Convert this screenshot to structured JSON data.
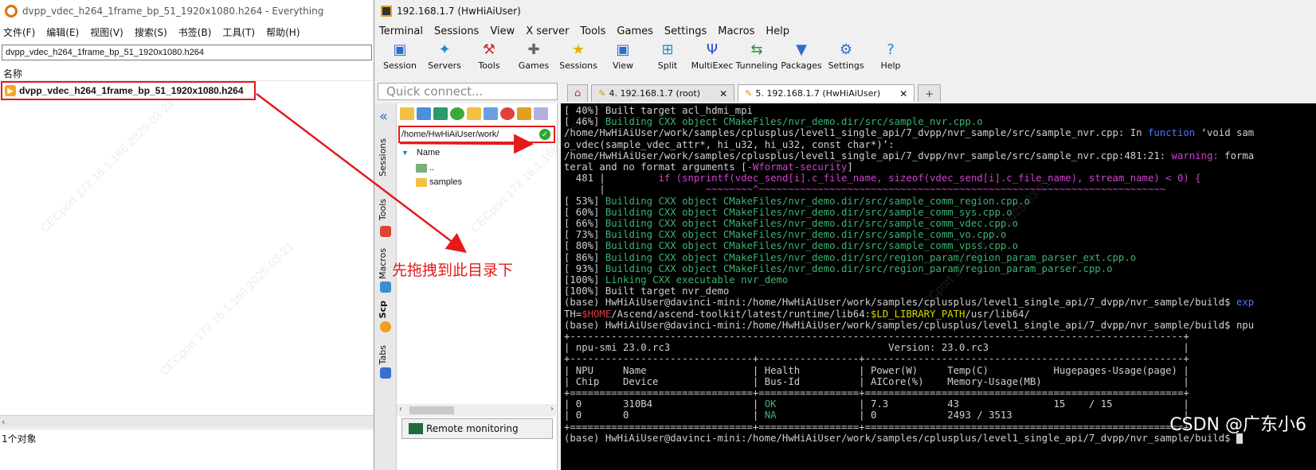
{
  "everything": {
    "title": "dvpp_vdec_h264_1frame_bp_51_1920x1080.h264 - Everything",
    "menu": [
      "文件(F)",
      "编辑(E)",
      "视图(V)",
      "搜索(S)",
      "书签(B)",
      "工具(T)",
      "帮助(H)"
    ],
    "search_value": "dvpp_vdec_h264_1frame_bp_51_1920x1080.h264",
    "column_name": "名称",
    "result_file": "dvpp_vdec_h264_1frame_bp_51_1920x1080.h264",
    "status": "1个对象"
  },
  "annotation_text": "先拖拽到此目录下",
  "watermark": "CSDN @广东小6",
  "moba": {
    "title": "192.168.1.7 (HwHiAiUser)",
    "menu": [
      "Terminal",
      "Sessions",
      "View",
      "X server",
      "Tools",
      "Games",
      "Settings",
      "Macros",
      "Help"
    ],
    "toolbar": [
      {
        "label": "Session",
        "icon": "monitor-icon",
        "color": "#2a6fc9"
      },
      {
        "label": "Servers",
        "icon": "servers-icon",
        "color": "#1a8fd0"
      },
      {
        "label": "Tools",
        "icon": "tools-icon",
        "color": "#c33"
      },
      {
        "label": "Games",
        "icon": "gamepad-icon",
        "color": "#666"
      },
      {
        "label": "Sessions",
        "icon": "star-icon",
        "color": "#e8b000"
      },
      {
        "label": "View",
        "icon": "view-icon",
        "color": "#2a6fc9"
      },
      {
        "label": "Split",
        "icon": "split-icon",
        "color": "#1a8fd0"
      },
      {
        "label": "MultiExec",
        "icon": "multiexec-icon",
        "color": "#2a4fc9"
      },
      {
        "label": "Tunneling",
        "icon": "tunneling-icon",
        "color": "#2a8f2a"
      },
      {
        "label": "Packages",
        "icon": "packages-icon",
        "color": "#2a6fc9"
      },
      {
        "label": "Settings",
        "icon": "settings-icon",
        "color": "#2a6fc9"
      },
      {
        "label": "Help",
        "icon": "help-icon",
        "color": "#1a7fe0"
      }
    ],
    "quick_connect_placeholder": "Quick connect...",
    "tabs": [
      {
        "label": "4. 192.168.1.7 (root)",
        "active": false
      },
      {
        "label": "5. 192.168.1.7 (HwHiAiUser)",
        "active": true
      }
    ],
    "vertical_tabs": [
      "Sessions",
      "Tools",
      "Macros",
      "Scp",
      "Tabs"
    ],
    "sftp_path": "/home/HwHiAiUser/work/",
    "sftp_header": "Name",
    "sftp_items": [
      "..",
      "samples"
    ],
    "remote_monitoring": "Remote monitoring",
    "terminal_lines": [
      {
        "parts": [
          {
            "t": "[ 40%] Built target acl_hdmi_mpi",
            "c": ""
          }
        ]
      },
      {
        "parts": [
          {
            "t": "[ 46%] ",
            "c": ""
          },
          {
            "t": "Building CXX object CMakeFiles/nvr_demo.dir/src/sample_nvr.cpp.o",
            "c": "g"
          }
        ]
      },
      {
        "parts": [
          {
            "t": "/home/HwHiAiUser/work/samples/cplusplus/level1_single_api/7_dvpp/nvr_sample/src/sample_nvr.cpp: In ",
            "c": ""
          },
          {
            "t": "function",
            "c": "b"
          },
          {
            "t": " ‘void sam",
            "c": ""
          }
        ]
      },
      {
        "parts": [
          {
            "t": "o_vdec(sample_vdec_attr*, hi_u32, hi_u32, const char*)’:",
            "c": ""
          }
        ]
      },
      {
        "parts": [
          {
            "t": "/home/HwHiAiUser/work/samples/cplusplus/level1_single_api/7_dvpp/nvr_sample/src/sample_nvr.cpp:481:21: ",
            "c": ""
          },
          {
            "t": "warning:",
            "c": "m"
          },
          {
            "t": " forma",
            "c": ""
          }
        ]
      },
      {
        "parts": [
          {
            "t": "teral and no format arguments [",
            "c": ""
          },
          {
            "t": "-Wformat-security",
            "c": "m"
          },
          {
            "t": "]",
            "c": ""
          }
        ]
      },
      {
        "parts": [
          {
            "t": "  481 |         ",
            "c": ""
          },
          {
            "t": "if (snprintf(vdec_send[i].c_file_name, sizeof(vdec_send[i].c_file_name), stream_name) < 0) {",
            "c": "m"
          }
        ]
      },
      {
        "parts": [
          {
            "t": "      |                 ",
            "c": ""
          },
          {
            "t": "~~~~~~~~^~~~~~~~~~~~~~~~~~~~~~~~~~~~~~~~~~~~~~~~~~~~~~~~~~~~~~~~~~~~~~~~~~~~~~",
            "c": "m"
          }
        ]
      },
      {
        "parts": [
          {
            "t": "[ 53%] ",
            "c": ""
          },
          {
            "t": "Building CXX object CMakeFiles/nvr_demo.dir/src/sample_comm_region.cpp.o",
            "c": "g"
          }
        ]
      },
      {
        "parts": [
          {
            "t": "[ 60%] ",
            "c": ""
          },
          {
            "t": "Building CXX object CMakeFiles/nvr_demo.dir/src/sample_comm_sys.cpp.o",
            "c": "g"
          }
        ]
      },
      {
        "parts": [
          {
            "t": "[ 66%] ",
            "c": ""
          },
          {
            "t": "Building CXX object CMakeFiles/nvr_demo.dir/src/sample_comm_vdec.cpp.o",
            "c": "g"
          }
        ]
      },
      {
        "parts": [
          {
            "t": "[ 73%] ",
            "c": ""
          },
          {
            "t": "Building CXX object CMakeFiles/nvr_demo.dir/src/sample_comm_vo.cpp.o",
            "c": "g"
          }
        ]
      },
      {
        "parts": [
          {
            "t": "[ 80%] ",
            "c": ""
          },
          {
            "t": "Building CXX object CMakeFiles/nvr_demo.dir/src/sample_comm_vpss.cpp.o",
            "c": "g"
          }
        ]
      },
      {
        "parts": [
          {
            "t": "[ 86%] ",
            "c": ""
          },
          {
            "t": "Building CXX object CMakeFiles/nvr_demo.dir/src/region_param/region_param_parser_ext.cpp.o",
            "c": "g"
          }
        ]
      },
      {
        "parts": [
          {
            "t": "[ 93%] ",
            "c": ""
          },
          {
            "t": "Building CXX object CMakeFiles/nvr_demo.dir/src/region_param/region_param_parser.cpp.o",
            "c": "g"
          }
        ]
      },
      {
        "parts": [
          {
            "t": "[100%] ",
            "c": ""
          },
          {
            "t": "Linking CXX executable nvr_demo",
            "c": "g"
          }
        ]
      },
      {
        "parts": [
          {
            "t": "[100%] Built target nvr_demo",
            "c": ""
          }
        ]
      },
      {
        "parts": [
          {
            "t": "(base) HwHiAiUser@davinci-mini:/home/HwHiAiUser/work/samples/cplusplus/level1_single_api/7_dvpp/nvr_sample/build$ ",
            "c": ""
          },
          {
            "t": "exp",
            "c": "b"
          }
        ]
      },
      {
        "parts": [
          {
            "t": "TH=",
            "c": ""
          },
          {
            "t": "$HOME",
            "c": "r"
          },
          {
            "t": "/Ascend/ascend-toolkit/latest/runtime/lib64:",
            "c": ""
          },
          {
            "t": "$LD_LIBRARY_PATH",
            "c": "y"
          },
          {
            "t": "/usr/lib64/",
            "c": ""
          }
        ]
      },
      {
        "parts": [
          {
            "t": "(base) HwHiAiUser@davinci-mini:/home/HwHiAiUser/work/samples/cplusplus/level1_single_api/7_dvpp/nvr_sample/build$ npu",
            "c": ""
          }
        ]
      },
      {
        "parts": [
          {
            "t": "+--------------------------------------------------------------------------------------------------------+",
            "c": ""
          }
        ]
      },
      {
        "parts": [
          {
            "t": "| npu-smi 23.0.rc3                                     Version: 23.0.rc3                                 |",
            "c": ""
          }
        ]
      },
      {
        "parts": [
          {
            "t": "+-------------------------------+-----------------+------------------------------------------------------+",
            "c": ""
          }
        ]
      },
      {
        "parts": [
          {
            "t": "| NPU     Name                  | Health          | Power(W)     Temp(C)           Hugepages-Usage(page) |",
            "c": ""
          }
        ]
      },
      {
        "parts": [
          {
            "t": "| Chip    Device                | Bus-Id          | AICore(%)    Memory-Usage(MB)                        |",
            "c": ""
          }
        ]
      },
      {
        "parts": [
          {
            "t": "+===============================+=================+======================================================+",
            "c": ""
          }
        ]
      },
      {
        "parts": [
          {
            "t": "| 0       310B4                 | ",
            "c": ""
          },
          {
            "t": "OK",
            "c": "g"
          },
          {
            "t": "              | 7.3          43                15    / 15            |",
            "c": ""
          }
        ]
      },
      {
        "parts": [
          {
            "t": "| 0       0                     | ",
            "c": ""
          },
          {
            "t": "NA",
            "c": "g"
          },
          {
            "t": "              | 0            2493 / 3513                             |",
            "c": ""
          }
        ]
      },
      {
        "parts": [
          {
            "t": "+===============================+=================+======================================================+",
            "c": ""
          }
        ]
      },
      {
        "parts": [
          {
            "t": "(base) HwHiAiUser@davinci-mini:/home/HwHiAiUser/work/samples/cplusplus/level1_single_api/7_dvpp/nvr_sample/build$ ",
            "c": ""
          }
        ]
      }
    ]
  },
  "colors": {
    "annotation_red": "#e31b1b",
    "terminal_green": "#3cb371",
    "terminal_magenta": "#d040d0"
  }
}
